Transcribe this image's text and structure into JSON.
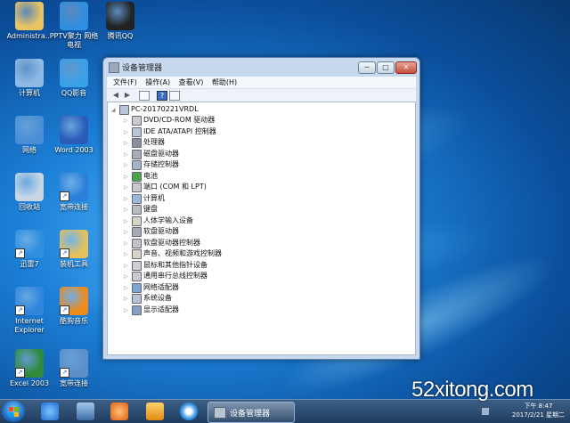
{
  "desktop_icons": [
    {
      "label": "Administra...",
      "icon": "folder-icon",
      "color": "#e9c463"
    },
    {
      "label": "PPTV聚力 网络电视",
      "icon": "pptv-icon",
      "color": "#2f8ee0"
    },
    {
      "label": "腾讯QQ",
      "icon": "qq-penguin-icon",
      "color": "#222222"
    },
    {
      "label": "计算机",
      "icon": "computer-icon",
      "color": "#8fb9e6"
    },
    {
      "label": "QQ影音",
      "icon": "qq-player-icon",
      "color": "#3aa0e6"
    },
    {
      "label": "网络",
      "icon": "network-icon",
      "color": "#4a8fd6"
    },
    {
      "label": "Word 2003",
      "icon": "word-icon",
      "color": "#2a5bb8"
    },
    {
      "label": "回收站",
      "icon": "recycle-bin-icon",
      "color": "#c8d6e4"
    },
    {
      "label": "宽带连接",
      "icon": "ie-broadband-icon",
      "color": "#2b7fd8"
    },
    {
      "label": "迅雷7",
      "icon": "thunder-icon",
      "color": "#2e8fe0"
    },
    {
      "label": "装机工具",
      "icon": "tools-folder-icon",
      "color": "#e6c05a"
    },
    {
      "label": "Internet Explorer",
      "icon": "internet-explorer-icon",
      "color": "#2f86dc"
    },
    {
      "label": "酷狗音乐",
      "icon": "kugou-icon",
      "color": "#f08a1a"
    },
    {
      "label": "Excel 2003",
      "icon": "excel-icon",
      "color": "#2f8a3a"
    },
    {
      "label": "宽带连接",
      "icon": "network-connection-icon",
      "color": "#5d8fc8"
    }
  ],
  "window": {
    "title": "设备管理器",
    "buttons": {
      "minimize": "─",
      "maximize": "□",
      "close": "✕"
    },
    "menu": [
      "文件(F)",
      "操作(A)",
      "查看(V)",
      "帮助(H)"
    ],
    "toolbar": [
      "back-arrow-icon",
      "forward-arrow-icon",
      "properties-icon",
      "help-icon",
      "view-icon"
    ],
    "root": "PC-20170221VRDL",
    "devices": [
      {
        "label": "DVD/CD-ROM 驱动器",
        "icon": "dvd-drive-icon"
      },
      {
        "label": "IDE ATA/ATAPI 控制器",
        "icon": "ide-controller-icon"
      },
      {
        "label": "处理器",
        "icon": "processor-icon"
      },
      {
        "label": "磁盘驱动器",
        "icon": "disk-drive-icon"
      },
      {
        "label": "存储控制器",
        "icon": "storage-controller-icon"
      },
      {
        "label": "电池",
        "icon": "battery-icon"
      },
      {
        "label": "端口 (COM 和 LPT)",
        "icon": "port-icon"
      },
      {
        "label": "计算机",
        "icon": "computer-icon"
      },
      {
        "label": "键盘",
        "icon": "keyboard-icon"
      },
      {
        "label": "人体学输入设备",
        "icon": "hid-icon"
      },
      {
        "label": "软盘驱动器",
        "icon": "floppy-drive-icon"
      },
      {
        "label": "软盘驱动器控制器",
        "icon": "floppy-controller-icon"
      },
      {
        "label": "声音、视频和游戏控制器",
        "icon": "sound-icon"
      },
      {
        "label": "鼠标和其他指针设备",
        "icon": "mouse-icon"
      },
      {
        "label": "通用串行总线控制器",
        "icon": "usb-icon"
      },
      {
        "label": "网络适配器",
        "icon": "network-adapter-icon"
      },
      {
        "label": "系统设备",
        "icon": "system-device-icon"
      },
      {
        "label": "显示适配器",
        "icon": "display-adapter-icon"
      }
    ]
  },
  "taskbar": {
    "pinned": [
      "internet-explorer-icon",
      "network-icon",
      "kugou-icon",
      "media-player-icon",
      "pptv-icon"
    ],
    "active_task": "设备管理器",
    "time": "下午 8:47",
    "date": "2017/2/21 星期二"
  },
  "watermark": "52xitong.com"
}
